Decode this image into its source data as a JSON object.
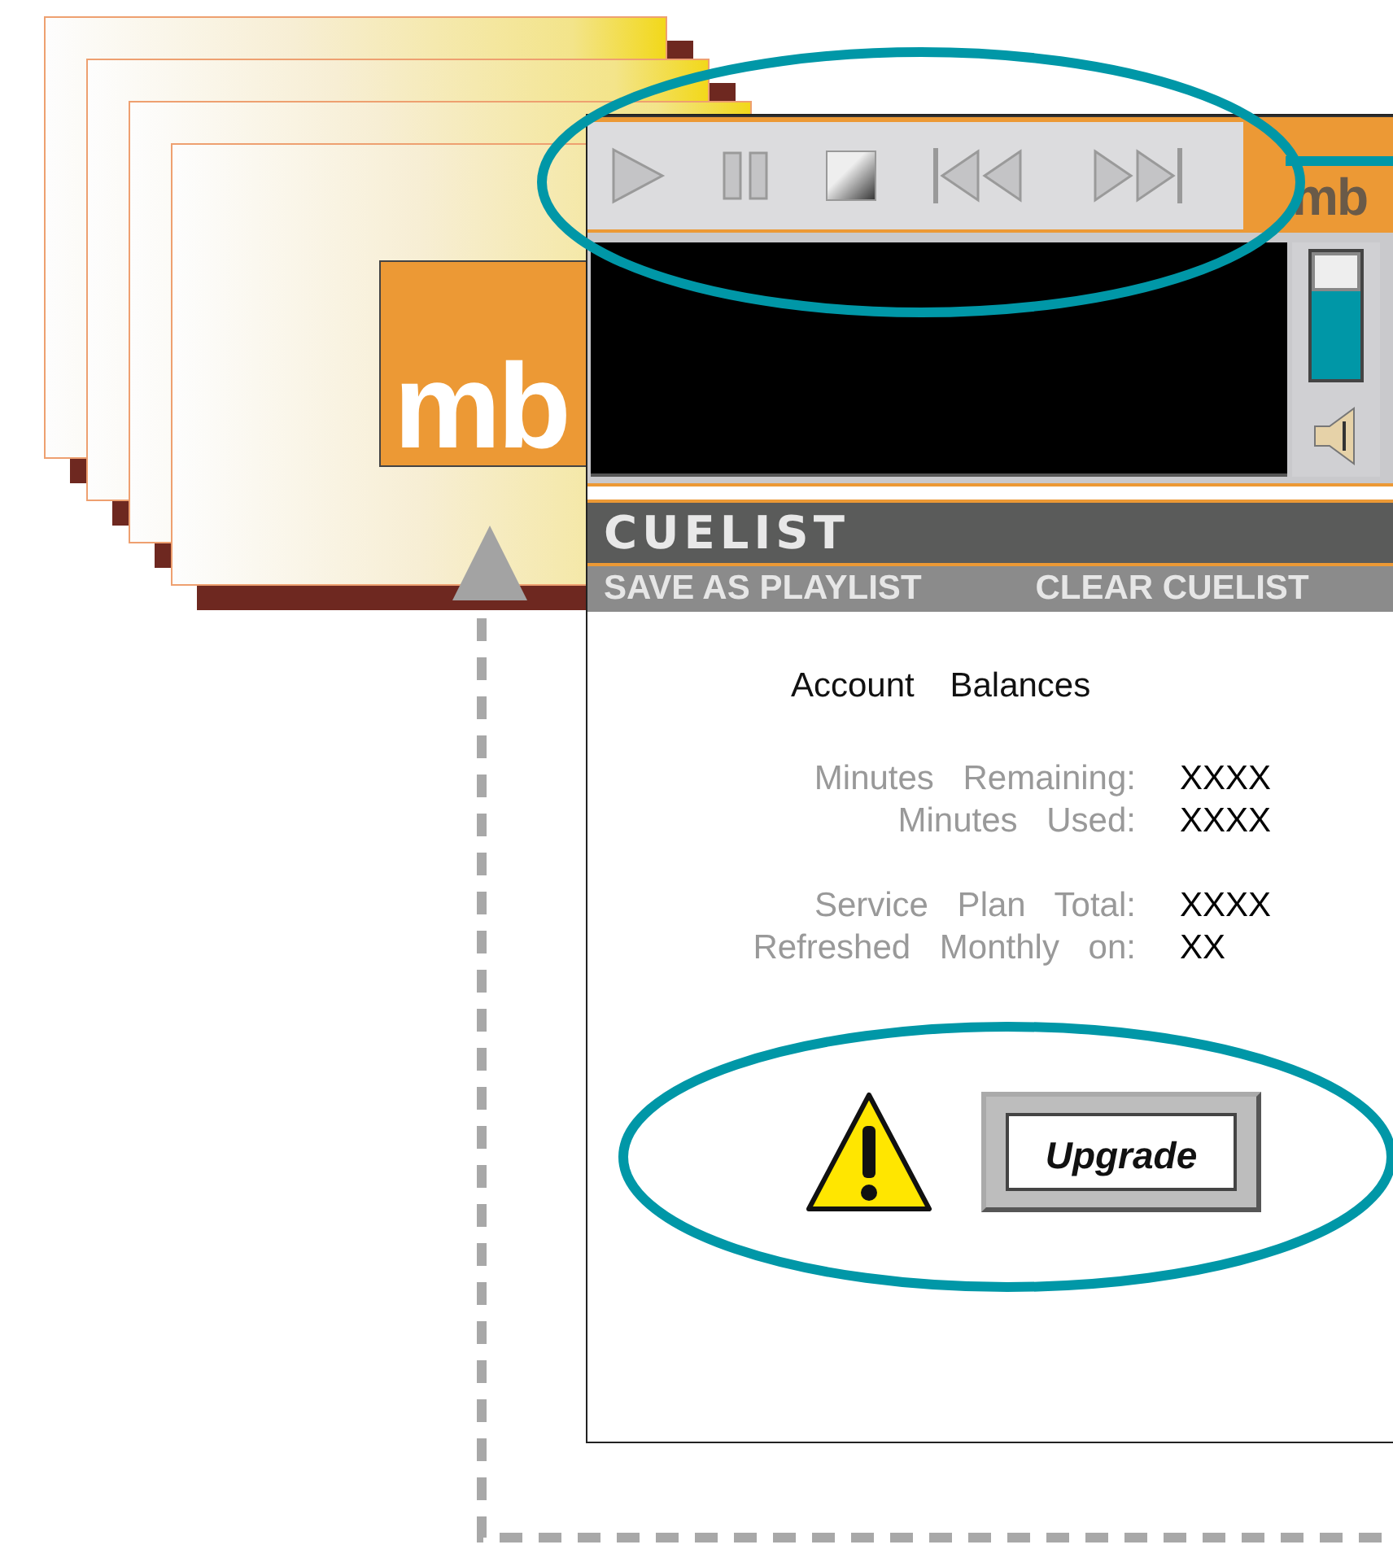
{
  "card_logo": "mb",
  "player": {
    "logo": "mb",
    "volume": {
      "level": 0.7
    },
    "cuelist": {
      "title": "CUELIST",
      "actions": [
        "SAVE AS PLAYLIST",
        "CLEAR CUELIST"
      ]
    },
    "account": {
      "title": "Account Balances",
      "groups": [
        [
          {
            "label": "Minutes Remaining:",
            "value": "XXXX"
          },
          {
            "label": "Minutes Used:",
            "value": "XXXX"
          }
        ],
        [
          {
            "label": "Service Plan Total:",
            "value": "XXXX"
          },
          {
            "label": "Refreshed Monthly on:",
            "value": "XX"
          }
        ]
      ]
    },
    "upgrade_button": "Upgrade"
  }
}
